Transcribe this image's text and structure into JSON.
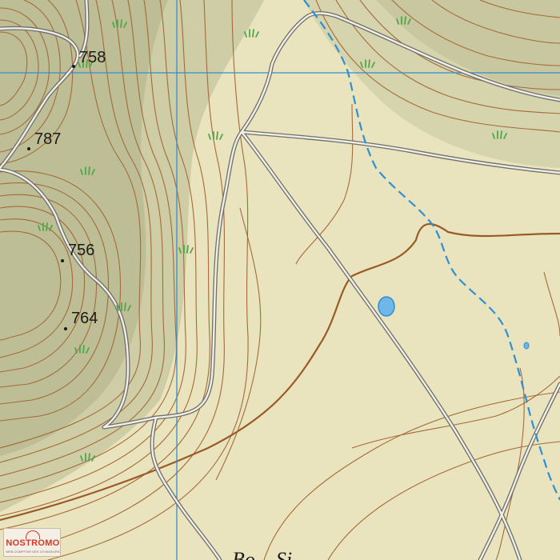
{
  "map": {
    "colors": {
      "background": "#e9e4bd",
      "slope_shade": "#b9b891",
      "contour": "#a46a3a",
      "contour_index": "#9a5a28",
      "road": "#6e6e6e",
      "grid": "#2f8fd6",
      "stream": "#2f8fd6",
      "pond": "#6fb7e6",
      "grass_symbol": "#4ea84a"
    },
    "spot_heights": [
      {
        "label": "758"
      },
      {
        "label": "787"
      },
      {
        "label": "756"
      },
      {
        "label": "764"
      }
    ],
    "place_label": "Bo    Si",
    "logo": {
      "name": "NOSTROMO",
      "tagline": "WEB COMPTOIR DES VOYAGEURS"
    }
  }
}
